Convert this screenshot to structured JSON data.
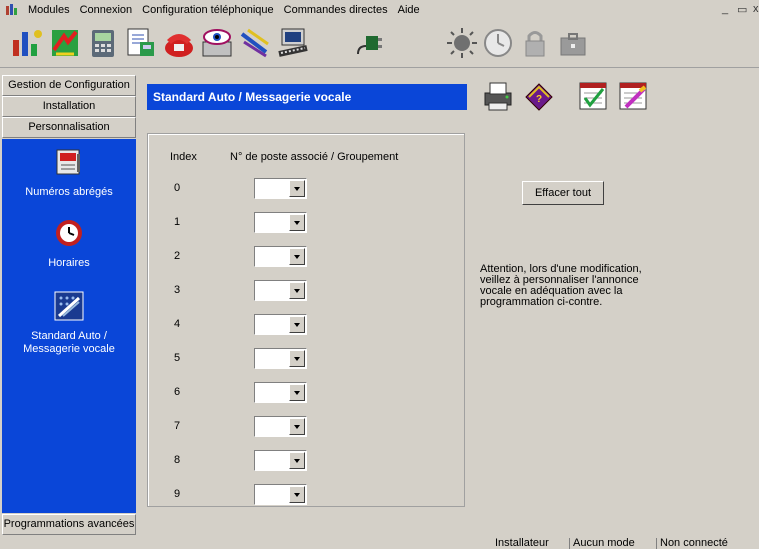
{
  "window": {
    "menu": [
      "Modules",
      "Connexion",
      "Configuration téléphonique",
      "Commandes directes",
      "Aide"
    ],
    "controls": [
      "minimize",
      "restore",
      "close"
    ]
  },
  "toolbar": {
    "icons": [
      "modules-icon",
      "exchange-icon",
      "phone-icon",
      "document-phone-icon",
      "phone-red-icon",
      "monitor-eye-icon",
      "pen-pencil-icon",
      "computer-keyboard-icon",
      "plug-icon",
      "sun-icon",
      "clock-icon",
      "padlock-icon",
      "briefcase-icon"
    ]
  },
  "sidebar": {
    "top_headers": [
      "Gestion de Configuration",
      "Installation",
      "Personnalisation"
    ],
    "items": [
      {
        "label": "Numéros abrégés",
        "icon": "phone-book-icon"
      },
      {
        "label": "Horaires",
        "icon": "clock-icon"
      },
      {
        "label": "Standard Auto / Messagerie vocale",
        "icon": "voicemail-icon"
      }
    ],
    "bottom_header": "Programmations avancées"
  },
  "main": {
    "title": "Standard Auto / Messagerie vocale",
    "action_icons": [
      "print-icon",
      "help-book-icon",
      "checklist-icon",
      "edit-list-icon"
    ],
    "table": {
      "headers": [
        "Index",
        "N° de poste associé / Groupement"
      ],
      "rows": [
        {
          "index": "0",
          "value": ""
        },
        {
          "index": "1",
          "value": ""
        },
        {
          "index": "2",
          "value": ""
        },
        {
          "index": "3",
          "value": ""
        },
        {
          "index": "4",
          "value": ""
        },
        {
          "index": "5",
          "value": ""
        },
        {
          "index": "6",
          "value": ""
        },
        {
          "index": "7",
          "value": ""
        },
        {
          "index": "8",
          "value": ""
        },
        {
          "index": "9",
          "value": ""
        }
      ]
    },
    "clear_button": "Effacer tout",
    "warning": "Attention, lors d'une modification, veillez à personnaliser l'annonce vocale en adéquation avec la programmation ci-contre."
  },
  "statusbar": [
    "Installateur",
    "Aucun mode",
    "Non connecté"
  ],
  "colors": {
    "accent_blue": "#0a46d8",
    "chrome": "#d4d0c8"
  }
}
